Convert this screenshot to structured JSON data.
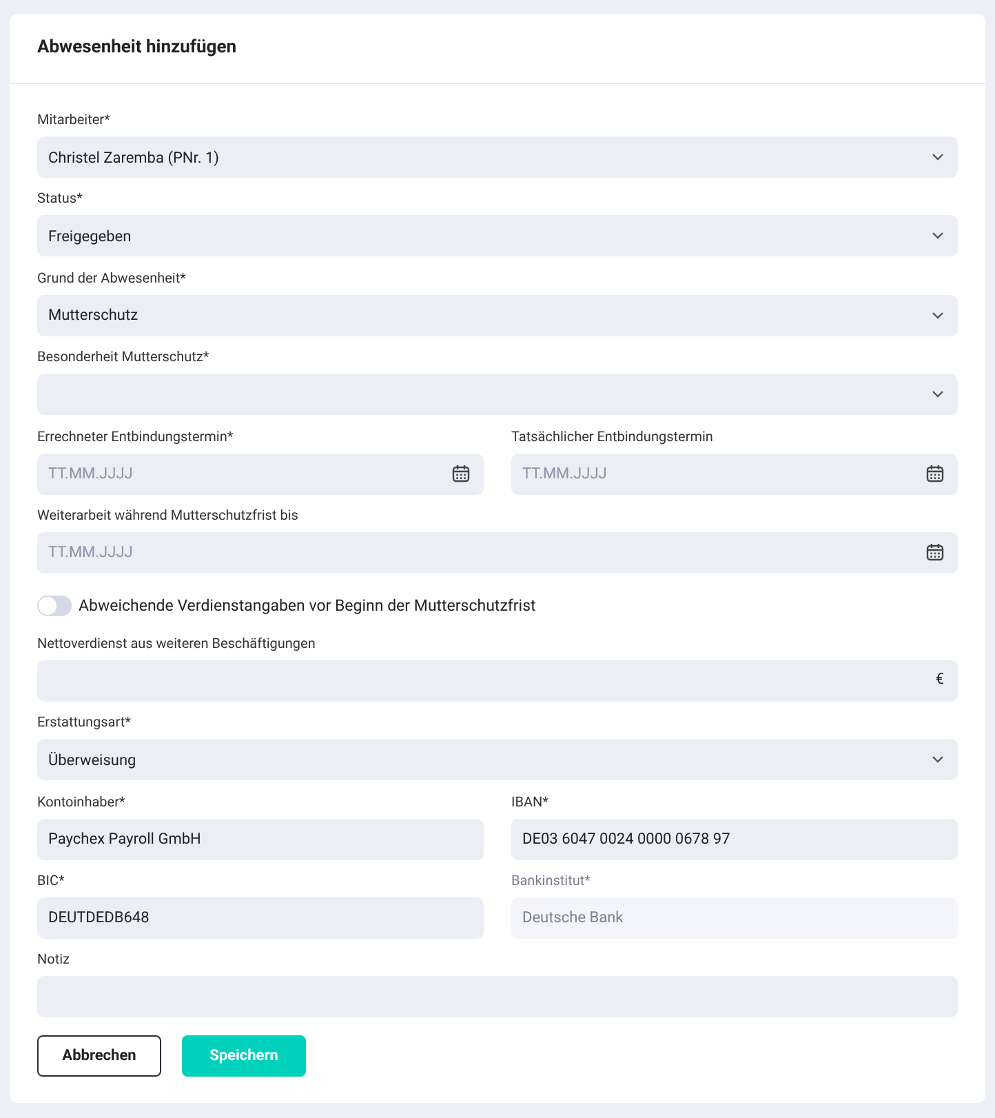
{
  "title": "Abwesenheit hinzufügen",
  "rows": [
    {
      "fields": [
        {
          "kind": "select",
          "label": "Mitarbeiter*",
          "value": "Christel Zaremba (PNr. 1)"
        }
      ]
    },
    {
      "fields": [
        {
          "kind": "select",
          "label": "Status*",
          "value": "Freigegeben"
        }
      ]
    },
    {
      "fields": [
        {
          "kind": "select",
          "label": "Grund der Abwesenheit*",
          "value": "Mutterschutz"
        }
      ]
    },
    {
      "fields": [
        {
          "kind": "select",
          "label": "Besonderheit Mutterschutz*"
        }
      ]
    },
    {
      "fields": [
        {
          "kind": "date",
          "label": "Errechneter Entbindungstermin*",
          "placeholder": "TT.MM.JJJJ"
        },
        {
          "kind": "date",
          "label": "Tatsächlicher Entbindungstermin",
          "placeholder": "TT.MM.JJJJ"
        }
      ]
    },
    {
      "fields": [
        {
          "kind": "date",
          "label": "Weiterarbeit während Mutterschutzfrist bis",
          "placeholder": "TT.MM.JJJJ"
        }
      ]
    },
    {
      "fields": [
        {
          "kind": "toggle",
          "label": "Abweichende Verdienstangaben vor Beginn der Mutterschutzfrist",
          "on": false
        }
      ]
    },
    {
      "fields": [
        {
          "kind": "money",
          "label": "Nettoverdienst aus weiteren Beschäftigungen",
          "unit": "€"
        }
      ]
    },
    {
      "fields": [
        {
          "kind": "select",
          "label": "Erstattungsart*",
          "value": "Überweisung"
        }
      ]
    },
    {
      "fields": [
        {
          "kind": "text",
          "label": "Kontoinhaber*",
          "value": "Paychex Payroll GmbH"
        },
        {
          "kind": "text",
          "label": "IBAN*",
          "value": "DE03 6047 0024 0000 0678 97"
        }
      ]
    },
    {
      "fields": [
        {
          "kind": "text",
          "label": "BIC*",
          "value": "DEUTDEDB648"
        },
        {
          "kind": "text",
          "label": "Bankinstitut*",
          "value": "Deutsche Bank",
          "disabled": true
        }
      ]
    },
    {
      "fields": [
        {
          "kind": "text",
          "label": "Notiz"
        }
      ]
    }
  ],
  "buttons": [
    {
      "kind": "secondary",
      "label": "Abbrechen"
    },
    {
      "kind": "primary",
      "label": "Speichern"
    }
  ]
}
